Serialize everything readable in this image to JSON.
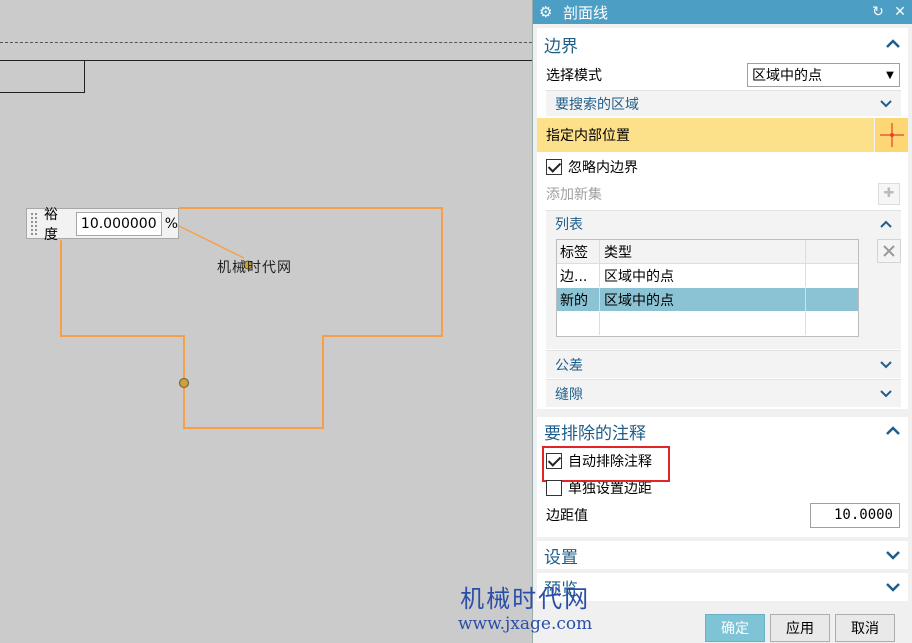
{
  "canvas": {
    "tolerance_label": "裕度",
    "tolerance_value": "10.000000",
    "tolerance_unit": "%",
    "note_text": "机械时代网",
    "watermark_cn": "机械时代网",
    "watermark_url": "www.jxage.com",
    "shape_color": "#f5a049"
  },
  "dialog": {
    "title": "剖面线",
    "accent": "#4d9ec5",
    "boundary": {
      "title": "边界",
      "select_mode_label": "选择模式",
      "select_mode_value": "区域中的点",
      "search_region_label": "要搜索的区域",
      "specify_interior_label": "指定内部位置",
      "ignore_inner_label": "忽略内边界",
      "ignore_inner_checked": true,
      "add_set_label": "添加新集",
      "list": {
        "title": "列表",
        "columns": [
          "标签",
          "类型"
        ],
        "rows": [
          {
            "tag": "边...",
            "type": "区域中的点",
            "selected": false
          },
          {
            "tag": "新的",
            "type": "区域中的点",
            "selected": true
          }
        ]
      },
      "tolerance_label": "公差",
      "gap_label": "缝隙"
    },
    "exclude": {
      "title": "要排除的注释",
      "auto_exclude_label": "自动排除注释",
      "auto_exclude_checked": true,
      "individual_margin_label": "单独设置边距",
      "individual_margin_checked": false,
      "margin_label": "边距值",
      "margin_value": "10.0000"
    },
    "settings_label": "设置",
    "preview_label": "预览",
    "buttons": {
      "ok": "确定",
      "apply": "应用",
      "cancel": "取消"
    }
  }
}
